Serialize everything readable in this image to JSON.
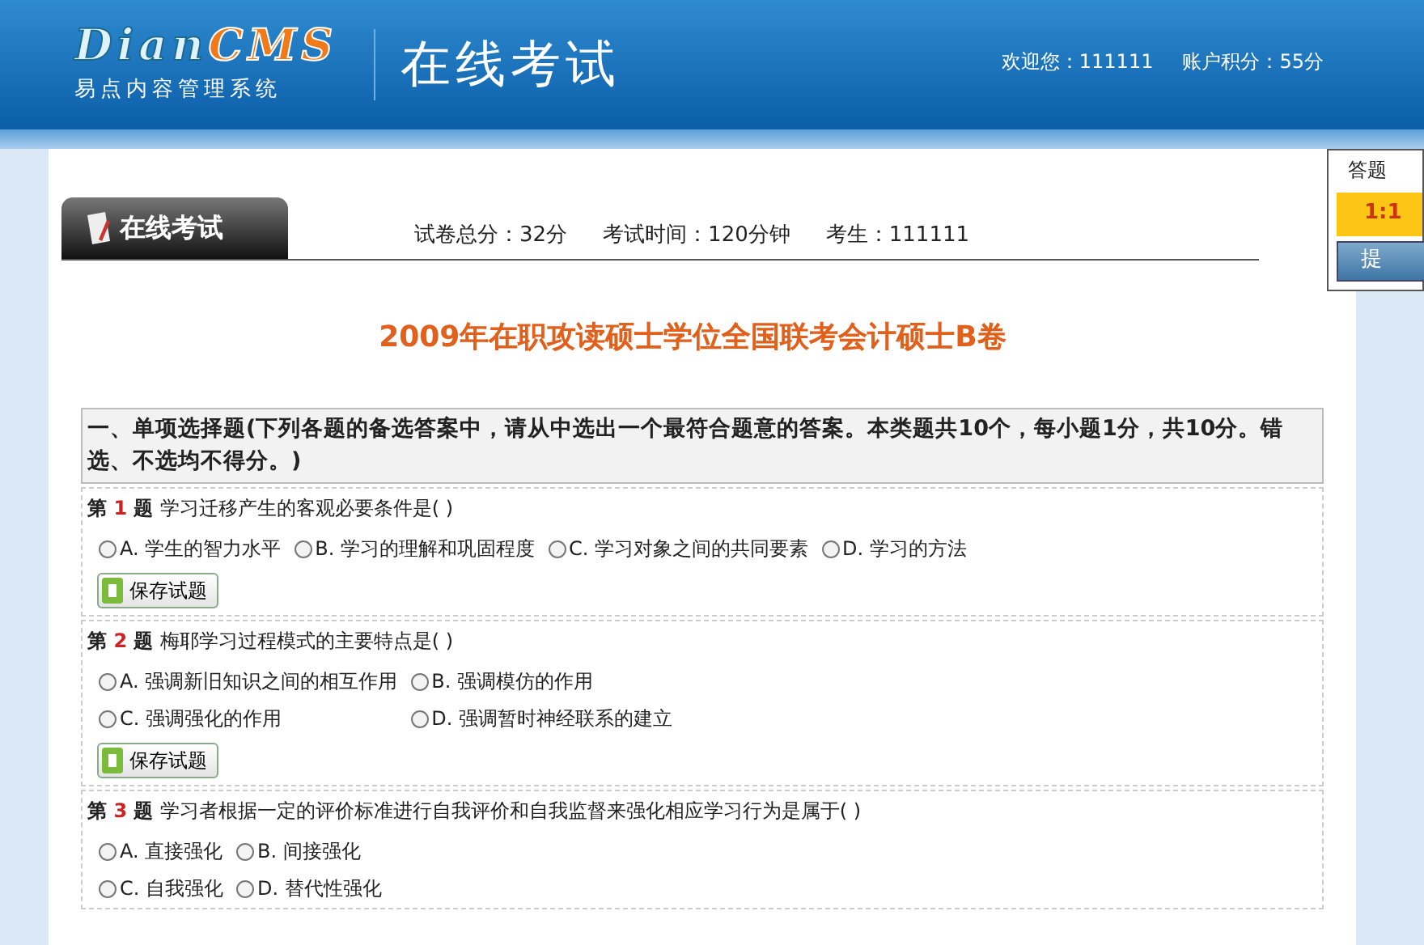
{
  "header": {
    "logo_latin": "Dian",
    "logo_accent": "CMS",
    "logo_subtitle": "易点内容管理系统",
    "page_title": "在线考试",
    "welcome": "欢迎您：111111",
    "points": "账户积分：55分"
  },
  "side_panel": {
    "title": "答题",
    "timer": "1:1",
    "submit": "提"
  },
  "exam_bar": {
    "tab": "在线考试",
    "total": "试卷总分：32分",
    "time": "考试时间：120分钟",
    "candidate": "考生：111111"
  },
  "exam_title": "2009年在职攻读硕士学位全国联考会计硕士B卷",
  "section": {
    "heading": "一、单项选择题(下列各题的备选答案中，请从中选出一个最符合题意的答案。本类题共10个，每小题1分，共10分。错选、不选均不得分。)"
  },
  "questions": [
    {
      "prefix": "第",
      "number": "1",
      "suffix": "题",
      "text": "学习迁移产生的客观必要条件是( )",
      "save": "保存试题",
      "rows": [
        [
          {
            "label": "A. 学生的智力水平",
            "selected": false
          },
          {
            "label": "B. 学习的理解和巩固程度",
            "selected": false
          },
          {
            "label": "C. 学习对象之间的共同要素",
            "selected": false
          },
          {
            "label": "D. 学习的方法",
            "selected": false
          }
        ]
      ]
    },
    {
      "prefix": "第",
      "number": "2",
      "suffix": "题",
      "text": "梅耶学习过程模式的主要特点是( )",
      "save": "保存试题",
      "rows": [
        [
          {
            "label": "A. 强调新旧知识之间的相互作用",
            "selected": false
          },
          {
            "label": "B. 强调模仿的作用",
            "selected": false
          }
        ],
        [
          {
            "label": "C. 强调强化的作用",
            "selected": false
          },
          {
            "label": "D. 强调暂时神经联系的建立",
            "selected": false
          }
        ]
      ]
    },
    {
      "prefix": "第",
      "number": "3",
      "suffix": "题",
      "text": "学习者根据一定的评价标准进行自我评价和自我监督来强化相应学习行为是属于( )",
      "rows": [
        [
          {
            "label": "A. 直接强化",
            "selected": false
          },
          {
            "label": "B. 间接强化",
            "selected": false
          }
        ],
        [
          {
            "label": "C. 自我强化",
            "selected": false
          },
          {
            "label": "D. 替代性强化",
            "selected": false
          }
        ]
      ]
    }
  ]
}
